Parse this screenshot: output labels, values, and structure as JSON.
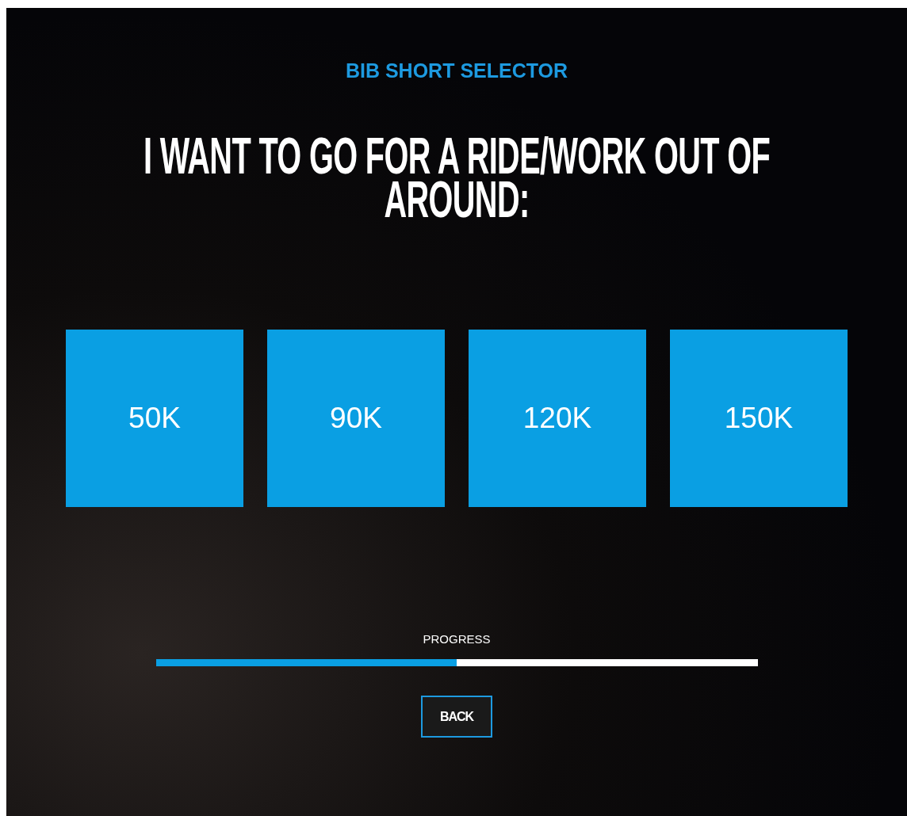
{
  "header": {
    "title": "BIB SHORT SELECTOR"
  },
  "question": "I WANT TO GO FOR A RIDE/WORK OUT OF AROUND:",
  "options": [
    {
      "label": "50K"
    },
    {
      "label": "90K"
    },
    {
      "label": "120K"
    },
    {
      "label": "150K"
    }
  ],
  "progress": {
    "label": "PROGRESS",
    "level": 0.5
  },
  "buttons": [
    {
      "kind": "back",
      "label": "BACK"
    }
  ]
}
